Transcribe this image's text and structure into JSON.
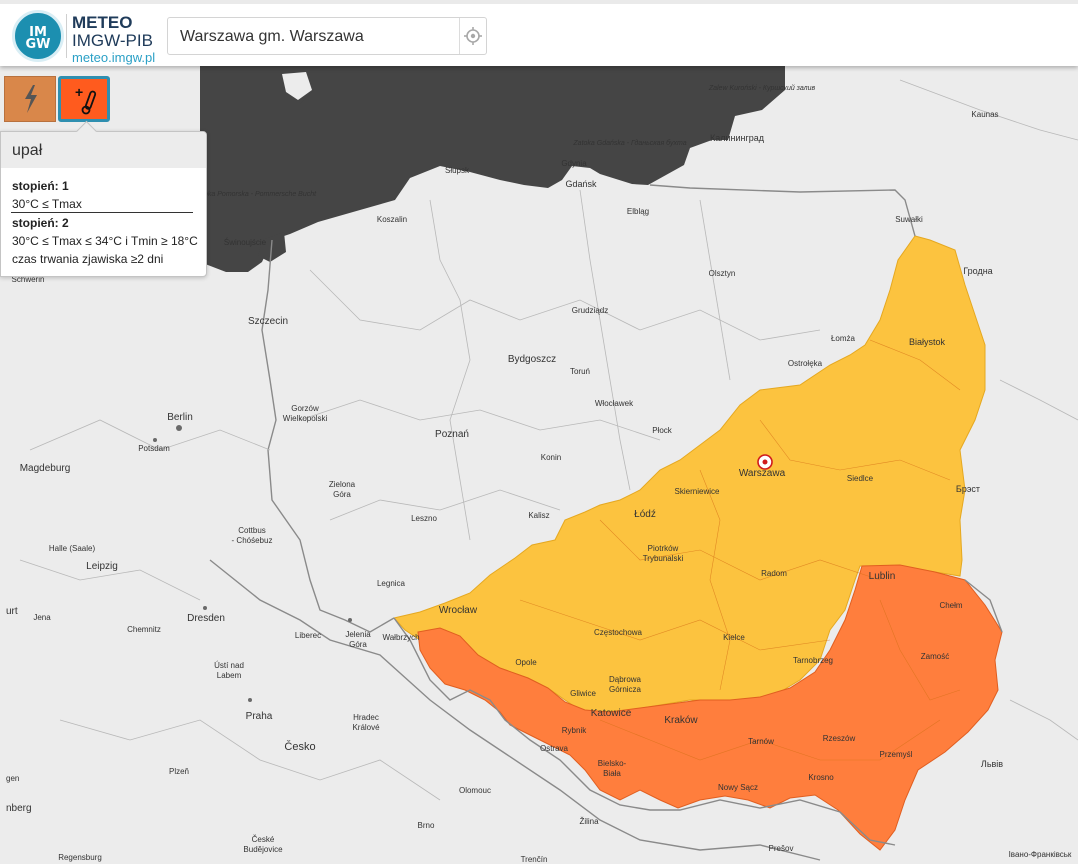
{
  "header": {
    "logo_text": "IM GW",
    "brand_title": "METEO",
    "brand_subtitle": "IMGW-PIB",
    "brand_url": "meteo.imgw.pl",
    "search_value": "Warszawa gm. Warszawa"
  },
  "layers": {
    "storm_icon": "lightning-icon",
    "heat_icon": "thermometer-plus-icon"
  },
  "legend": {
    "title": "upał",
    "level1_label": "stopień: 1",
    "level1_condition": "30°C ≤ Tmax",
    "level2_label": "stopień: 2",
    "level2_condition": "30°C ≤ Tmax ≤ 34°C i Tmin ≥ 18°C",
    "level2_duration": "czas trwania zjawiska ≥2 dni"
  },
  "colors": {
    "level1": "#fcc33f",
    "level2": "#ff7e3d",
    "sea": "#454545",
    "land": "#ececec",
    "accent": "#2aa0c6"
  },
  "map": {
    "sea_labels": {
      "szczecin_bay": "Zatoka Pomorska - Pommersche Bucht",
      "gdansk_bay": "Zatoka Gdańska - Гданьская бухта",
      "curonian": "Zalew Kuroński - Куршский залив"
    },
    "cities": {
      "kaliningrad": "Калининград",
      "kaunas": "Kaunas",
      "gdynia": "Gdynia",
      "gdansk": "Gdańsk",
      "slupsk": "Słupsk",
      "elblag": "Elbląg",
      "koszalin": "Koszalin",
      "suwalki": "Suwałki",
      "grodno": "Гродна",
      "swinoujscie": "Świnoujście",
      "schwerin": "Schwerin",
      "olsztyn": "Olsztyn",
      "grudziadz": "Grudziądz",
      "szczecin": "Szczecin",
      "bialystok": "Białystok",
      "lomza": "Łomża",
      "bydgoszcz": "Bydgoszcz",
      "torun": "Toruń",
      "ostroleka": "Ostrołęka",
      "berlin": "Berlin",
      "gorzow": "Gorzów Wielkopolski",
      "wloclawek": "Włocławek",
      "plock": "Płock",
      "poznan": "Poznań",
      "potsdam": "Potsdam",
      "konin": "Konin",
      "warszawa": "Warszawa",
      "magdeburg": "Magdeburg",
      "siedlce": "Siedlce",
      "zielona_gora": "Zielona Góra",
      "brest": "Брэст",
      "skierniewice": "Skierniewice",
      "lodz": "Łódź",
      "kalisz": "Kalisz",
      "leszno": "Leszno",
      "cottbus": "Cottbus - Chóśebuz",
      "halle": "Halle (Saale)",
      "piotrkow": "Piotrków Trybunalski",
      "leipzig": "Leipzig",
      "radom": "Radom",
      "lublin": "Lublin",
      "legnica": "Legnica",
      "wroclaw": "Wrocław",
      "dresden": "Dresden",
      "chelm": "Chełm",
      "jena": "Jena",
      "czestochowa": "Częstochowa",
      "kielce": "Kielce",
      "chemnitz": "Chemnitz",
      "jelenia_gora": "Jelenia Góra",
      "walbrzych": "Wałbrzych",
      "liberec": "Liberec",
      "opole": "Opole",
      "tarnobrzeg": "Tarnobrzeg",
      "zamosc": "Zamość",
      "usti": "Ústí nad Labem",
      "dabrowa": "Dąbrowa Górnicza",
      "gliwice": "Gliwice",
      "katowice": "Katowice",
      "krakow": "Kraków",
      "praha": "Praha",
      "hradec": "Hradec Králové",
      "rybnik": "Rybnik",
      "rzeszow": "Rzeszów",
      "tarnow": "Tarnów",
      "przemysl": "Przemyśl",
      "cesko": "Česko",
      "ostrava": "Ostrava",
      "lviv": "Львів",
      "bielsko": "Bielsko-Biała",
      "plzen": "Plzeň",
      "krosno": "Krosno",
      "olomouc": "Olomouc",
      "nowy_sacz": "Nowy Sącz",
      "brno": "Brno",
      "zilina": "Žilina",
      "ceske_budejovice": "České Budějovice",
      "presov": "Prešov",
      "regensburg": "Regensburg",
      "trencin": "Trenčín",
      "ivano": "Івано-Франківськ",
      "edge_urt": "urt",
      "edge_gen": "gen",
      "edge_nberg": "nberg"
    }
  }
}
